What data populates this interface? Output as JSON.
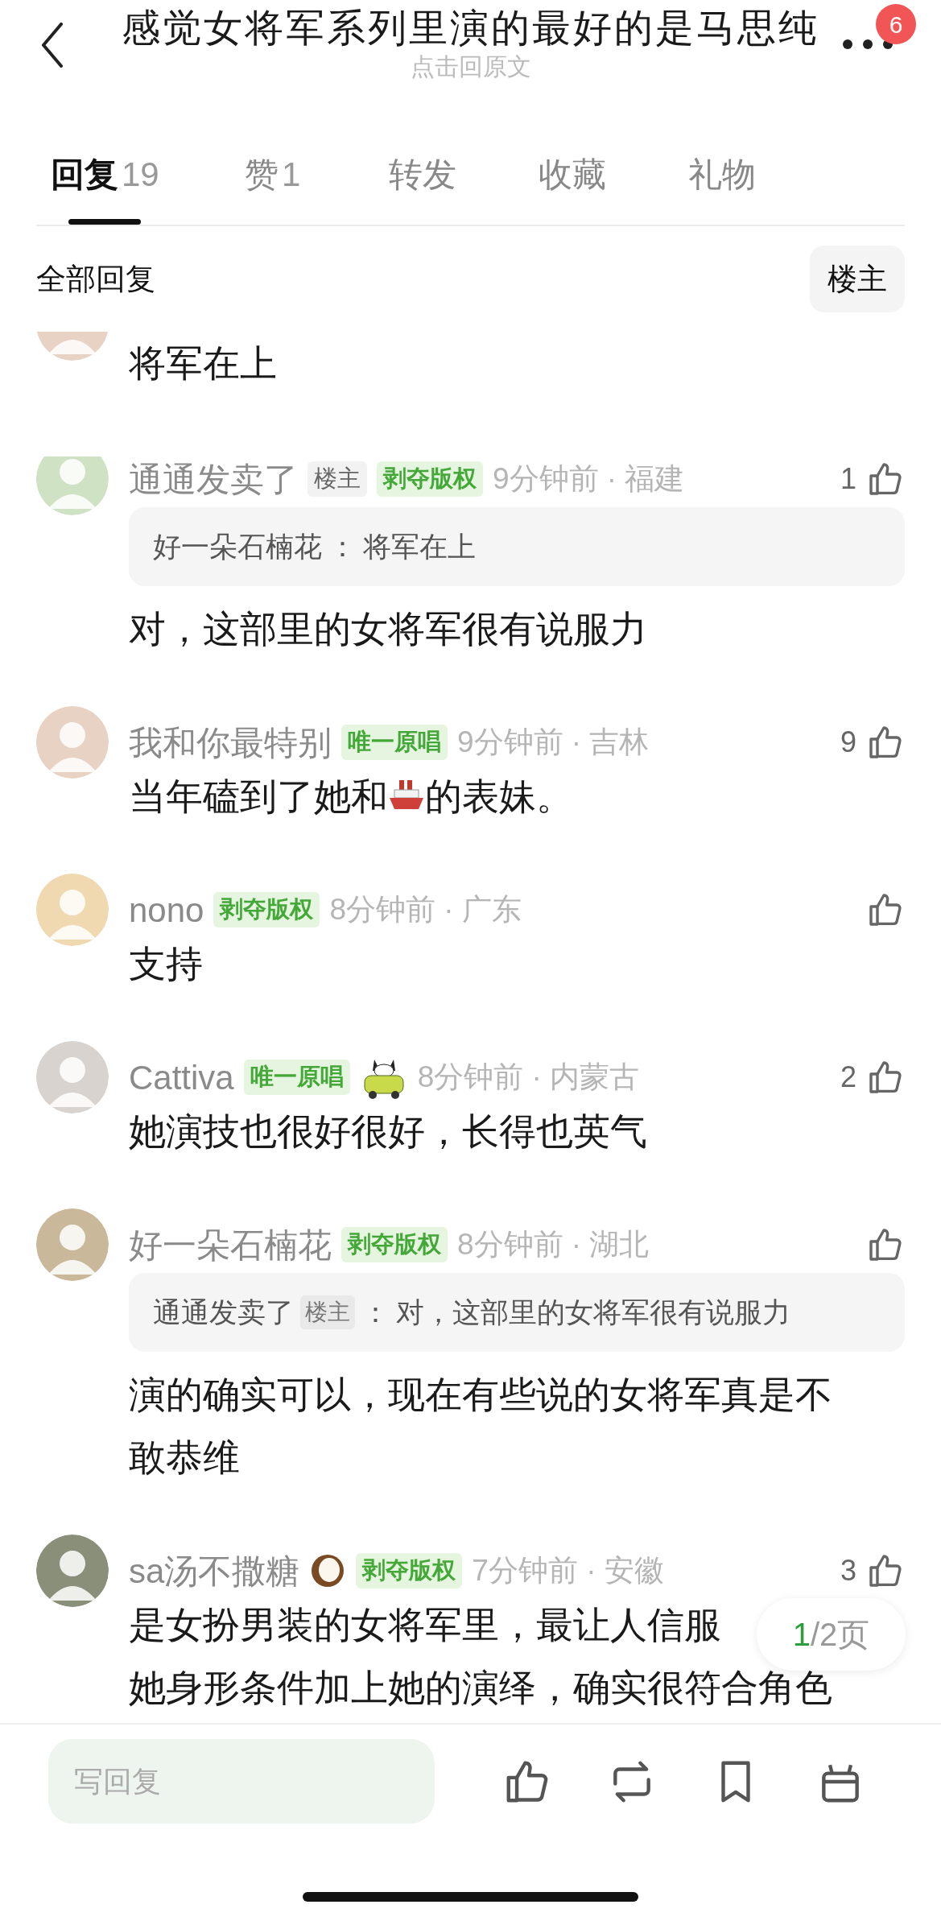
{
  "header": {
    "title": "感觉女将军系列里演的最好的是马思纯",
    "subtitle": "点击回原文",
    "badge": "6"
  },
  "tabs": [
    {
      "label": "回复",
      "count": "19",
      "selected": true
    },
    {
      "label": "赞",
      "count": "1",
      "selected": false
    },
    {
      "label": "转发",
      "selected": false
    },
    {
      "label": "收藏",
      "selected": false
    },
    {
      "label": "礼物",
      "selected": false
    }
  ],
  "section": {
    "title": "全部回复",
    "filter_button": "楼主"
  },
  "partial_comment": {
    "lines": [
      [
        {
          "kind": "text",
          "text": "将军在上"
        }
      ]
    ]
  },
  "comments": [
    {
      "name": "通通发卖了",
      "badges": [
        {
          "kind": "owner",
          "text": "楼主"
        },
        {
          "kind": "green",
          "text": "剥夺版权"
        }
      ],
      "time": "9分钟前 · 福建",
      "likes": "1",
      "quote": {
        "name": "好一朵石楠花",
        "separator": "：",
        "text": "将军在上"
      },
      "lines": [
        [
          {
            "kind": "text",
            "text": "对，这部里的女将军很有说服力"
          }
        ]
      ]
    },
    {
      "name": "我和你最特别",
      "badges": [
        {
          "kind": "green",
          "text": "唯一原唱"
        }
      ],
      "time": "9分钟前 · 吉林",
      "likes": "9",
      "lines": [
        [
          {
            "kind": "text",
            "text": "当年磕到了她和"
          },
          {
            "kind": "ship"
          },
          {
            "kind": "text",
            "text": "的表妹。"
          }
        ]
      ]
    },
    {
      "name": "nono",
      "badges": [
        {
          "kind": "green",
          "text": "剥夺版权"
        }
      ],
      "time": "8分钟前 · 广东",
      "lines": [
        [
          {
            "kind": "text",
            "text": "支持"
          }
        ]
      ]
    },
    {
      "name": "Cattiva",
      "badges": [
        {
          "kind": "green",
          "text": "唯一原唱"
        },
        {
          "kind": "cat"
        }
      ],
      "time": "8分钟前 · 内蒙古",
      "likes": "2",
      "lines": [
        [
          {
            "kind": "text",
            "text": "她演技也很好很好，长得也英气"
          }
        ]
      ]
    },
    {
      "name": "好一朵石楠花",
      "badges": [
        {
          "kind": "green",
          "text": "剥夺版权"
        }
      ],
      "time": "8分钟前 · 湖北",
      "quote": {
        "name": "通通发卖了",
        "owner_badge": "楼主",
        "separator": "：",
        "text": "对，这部里的女将军很有说服力"
      },
      "lines": [
        [
          {
            "kind": "text",
            "text": "演的确实可以，现在有些说的女将军真是不"
          }
        ],
        [
          {
            "kind": "text",
            "text": "敢恭维"
          }
        ]
      ]
    },
    {
      "name": "sa汤不撒糖",
      "name_icon": {
        "kind": "coconut"
      },
      "badges": [
        {
          "kind": "green",
          "text": "剥夺版权"
        }
      ],
      "time": "7分钟前 · 安徽",
      "likes": "3",
      "lines": [
        [
          {
            "kind": "text",
            "text": "是女扮男装的女将军里，最让人信服"
          }
        ],
        [
          {
            "kind": "text",
            "text": "她身形条件加上她的演绎，确实很符合角色"
          }
        ]
      ]
    }
  ],
  "pager": {
    "current": "1",
    "rest": "/2页"
  },
  "reply_bar": {
    "placeholder": "写回复"
  }
}
